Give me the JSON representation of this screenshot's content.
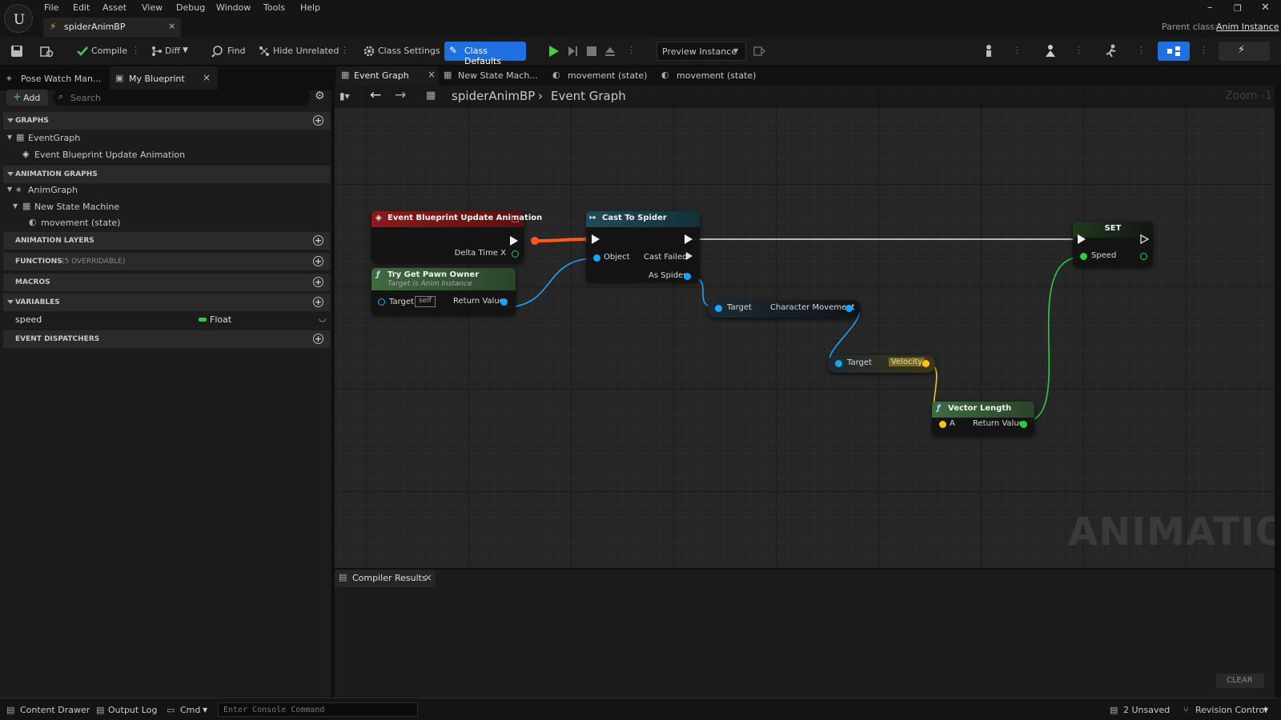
{
  "app": {
    "menu": [
      "File",
      "Edit",
      "Asset",
      "View",
      "Debug",
      "Window",
      "Tools",
      "Help"
    ],
    "document_tab": "spiderAnimBP",
    "parent_class_label": "Parent class:",
    "parent_class_value": "Anim Instance"
  },
  "toolbar": {
    "compile": "Compile",
    "diff": "Diff",
    "find": "Find",
    "hide_unrelated": "Hide Unrelated",
    "class_settings": "Class Settings",
    "class_defaults": "Class Defaults",
    "preview_instance": "Preview Instance"
  },
  "left_panel": {
    "tabs": [
      "Pose Watch Man...",
      "My Blueprint"
    ],
    "add_label": "Add",
    "search_placeholder": "Search",
    "sections": {
      "graphs": "GRAPHS",
      "animation_graphs": "ANIMATION GRAPHS",
      "animation_layers": "ANIMATION LAYERS",
      "functions": "FUNCTIONS",
      "functions_note": "(5 OVERRIDABLE)",
      "macros": "MACROS",
      "variables": "VARIABLES",
      "event_dispatchers": "EVENT DISPATCHERS"
    },
    "tree": {
      "event_graph": "EventGraph",
      "event_update": "Event Blueprint Update Animation",
      "anim_graph": "AnimGraph",
      "state_machine": "New State Machine",
      "movement_state": "movement (state)"
    },
    "variables": [
      {
        "name": "speed",
        "type": "Float",
        "color": "#2ecc40"
      }
    ]
  },
  "graph_tabs": [
    "Event Graph",
    "New State Mach...",
    "movement (state)",
    "movement (state)"
  ],
  "breadcrumb": {
    "root": "spiderAnimBP",
    "current": "Event Graph"
  },
  "zoom": "Zoom -1",
  "watermark": "ANIMATION",
  "nodes": {
    "event": {
      "title": "Event Blueprint Update Animation",
      "pin_delta": "Delta Time X"
    },
    "pawn": {
      "title": "Try Get Pawn Owner",
      "subtitle": "Target is Anim Instance",
      "target": "Target",
      "self": "self",
      "return": "Return Value"
    },
    "cast": {
      "title": "Cast To Spider",
      "object": "Object",
      "failed": "Cast Failed",
      "as": "As Spider"
    },
    "charmove": {
      "target": "Target",
      "out": "Character Movement"
    },
    "velocity": {
      "target": "Target",
      "out": "Velocity"
    },
    "vlength": {
      "title": "Vector Length",
      "a": "A",
      "return": "Return Value"
    },
    "set": {
      "title": "SET",
      "speed": "Speed"
    }
  },
  "compiler": {
    "tab": "Compiler Results",
    "clear": "CLEAR"
  },
  "status": {
    "content_drawer": "Content Drawer",
    "output_log": "Output Log",
    "cmd": "Cmd",
    "console_placeholder": "Enter Console Command",
    "unsaved": "2 Unsaved",
    "revision": "Revision Control"
  },
  "colors": {
    "exec_wire": "#ff5a1a",
    "object_pin": "#1aa4ff",
    "float_pin": "#2ecc40",
    "vector_pin": "#f5c518",
    "accent": "#1f6fe0"
  }
}
